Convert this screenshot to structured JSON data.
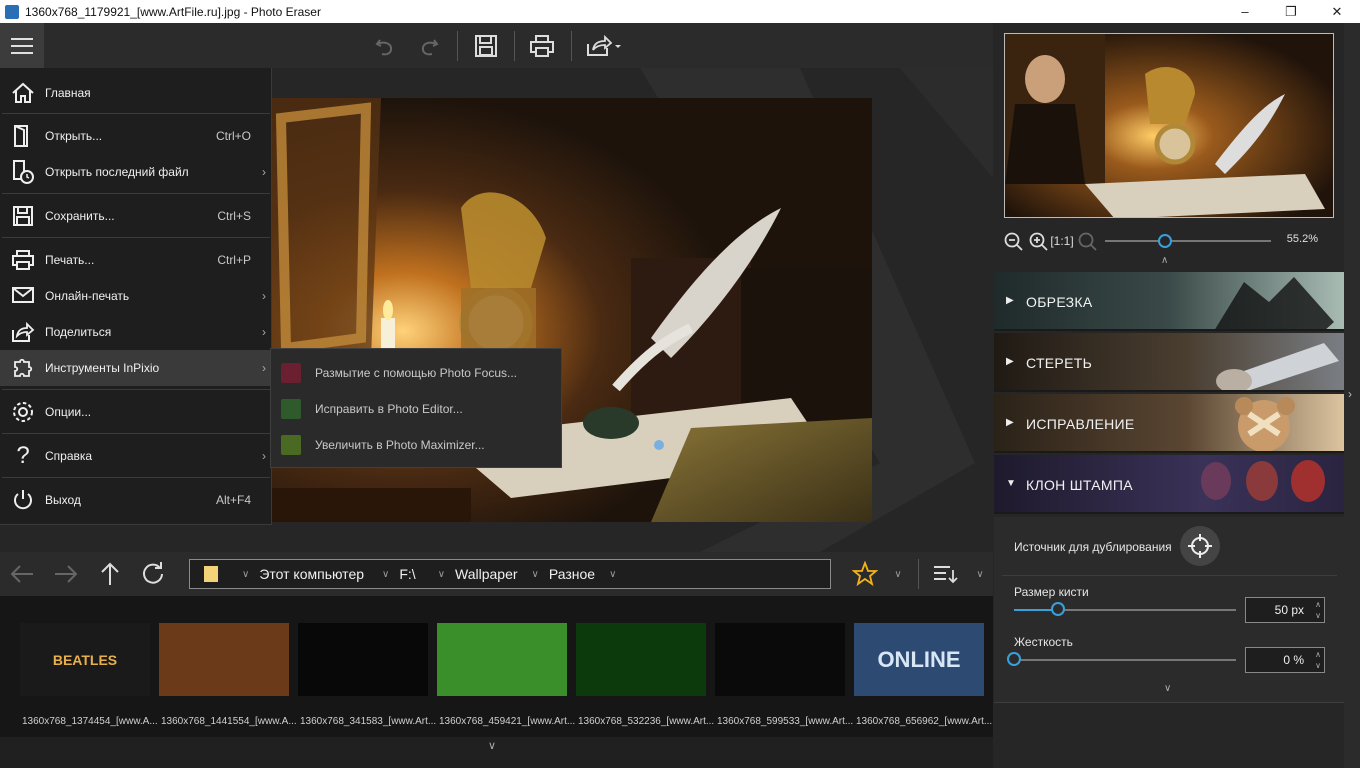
{
  "window": {
    "title": "1360x768_1179921_[www.ArtFile.ru].jpg - Photo Eraser"
  },
  "menu": {
    "items": [
      {
        "label": "Главная",
        "shortcut": ""
      },
      {
        "label": "Открыть...",
        "shortcut": "Ctrl+O"
      },
      {
        "label": "Открыть последний файл",
        "shortcut": ""
      },
      {
        "label": "Сохранить...",
        "shortcut": "Ctrl+S"
      },
      {
        "label": "Печать...",
        "shortcut": "Ctrl+P"
      },
      {
        "label": "Онлайн-печать",
        "shortcut": ""
      },
      {
        "label": "Поделиться",
        "shortcut": ""
      },
      {
        "label": "Инструменты InPixio",
        "shortcut": ""
      },
      {
        "label": "Опции...",
        "shortcut": ""
      },
      {
        "label": "Справка",
        "shortcut": ""
      },
      {
        "label": "Выход",
        "shortcut": "Alt+F4"
      }
    ],
    "submenu": [
      {
        "label": "Размытие с помощью Photo Focus...",
        "color": "#8a2b3a"
      },
      {
        "label": "Исправить в Photo Editor...",
        "color": "#3c6b3a"
      },
      {
        "label": "Увеличить в Photo Maximizer...",
        "color": "#5a7a2e"
      }
    ]
  },
  "path": {
    "segments": [
      "Этот компьютер",
      "F:\\",
      "Wallpaper",
      "Разное"
    ]
  },
  "filmstrip": [
    {
      "name": "1360x768_1374454_[www.A...",
      "bg": "#1a1a1a",
      "text": "BEATLES"
    },
    {
      "name": "1360x768_1441554_[www.A...",
      "bg": "#6b3a18",
      "text": ""
    },
    {
      "name": "1360x768_341583_[www.Art...",
      "bg": "#080808",
      "text": ""
    },
    {
      "name": "1360x768_459421_[www.Art...",
      "bg": "#3a8f2a",
      "text": ""
    },
    {
      "name": "1360x768_532236_[www.Art...",
      "bg": "#0d3a0d",
      "text": ""
    },
    {
      "name": "1360x768_599533_[www.Art...",
      "bg": "#0a0a0a",
      "text": ""
    },
    {
      "name": "1360x768_656962_[www.Art...",
      "bg": "#2d4a73",
      "text": "ONLINE"
    }
  ],
  "preview": {
    "zoom": "55.2%",
    "zoom_level": 0.36
  },
  "sections": [
    {
      "title": "ОБРЕЗКА",
      "color_a": "#2c3a3a",
      "color_b": "#9ab0a8"
    },
    {
      "title": "СТЕРЕТЬ",
      "color_a": "#2a2218",
      "color_b": "#6b6e72"
    },
    {
      "title": "ИСПРАВЛЕНИЕ",
      "color_a": "#3a2e22",
      "color_b": "#c9a57a"
    },
    {
      "title": "КЛОН ШТАМПА",
      "color_a": "#2a2438",
      "color_b": "#4a3f6a"
    }
  ],
  "clone": {
    "source_label": "Источник для дублирования",
    "brush_label": "Размер кисти",
    "brush_value": "50 px",
    "brush_level": 0.2,
    "hardness_label": "Жесткость",
    "hardness_value": "0 %",
    "hardness_level": 0.0
  }
}
